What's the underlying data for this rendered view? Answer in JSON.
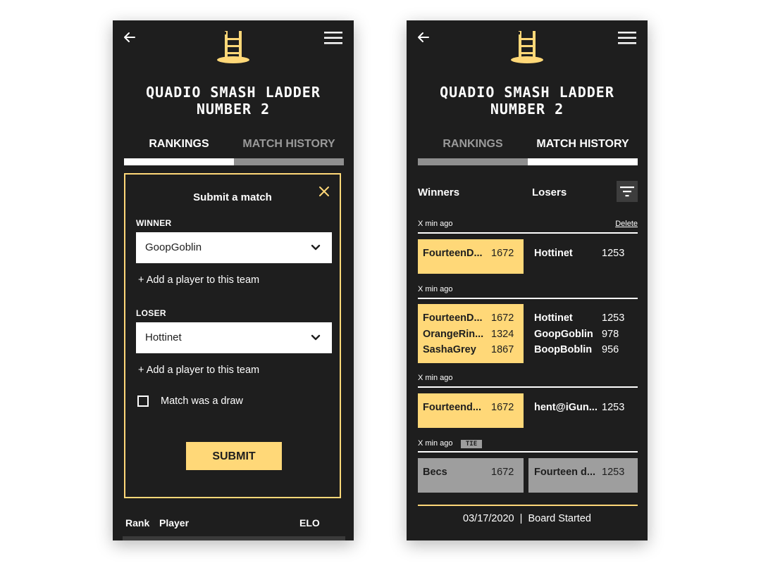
{
  "ladder_title_line1": "Quadio Smash Ladder",
  "ladder_title_line2": "Number 2",
  "tabs": {
    "rankings": "RANKINGS",
    "match_history": "MATCH HISTORY"
  },
  "colors": {
    "accent": "#ffd878",
    "background": "#1e1e1e",
    "tie": "#9e9e9e"
  },
  "submit_form": {
    "title": "Submit a match",
    "winner_label": "WINNER",
    "winner_value": "GoopGoblin",
    "add_player_winner": "+ Add a player to this team",
    "loser_label": "LOSER",
    "loser_value": "Hottinet",
    "add_player_loser": "+ Add a player to this team",
    "draw_label": "Match was a draw",
    "submit_label": "SUBMIT"
  },
  "rankings_header": {
    "rank": "Rank",
    "player": "Player",
    "elo": "ELO"
  },
  "history": {
    "winners_label": "Winners",
    "losers_label": "Losers",
    "matches": [
      {
        "time": "X min ago",
        "delete": "Delete",
        "winners": [
          {
            "name": "FourteenD...",
            "elo": "1672"
          }
        ],
        "losers": [
          {
            "name": "Hottinet",
            "elo": "1253"
          }
        ]
      },
      {
        "time": "X min ago",
        "winners": [
          {
            "name": "FourteenD...",
            "elo": "1672"
          },
          {
            "name": "OrangeRin...",
            "elo": "1324"
          },
          {
            "name": "SashaGrey",
            "elo": "1867"
          }
        ],
        "losers": [
          {
            "name": "Hottinet",
            "elo": "1253"
          },
          {
            "name": "GoopGoblin",
            "elo": "978"
          },
          {
            "name": "BoopBoblin",
            "elo": "956"
          }
        ]
      },
      {
        "time": "X min ago",
        "winners": [
          {
            "name": "Fourteend...",
            "elo": "1672"
          }
        ],
        "losers": [
          {
            "name": "hent@iGun...",
            "elo": "1253"
          }
        ]
      },
      {
        "time": "X min ago",
        "tie": "TIE",
        "winners": [
          {
            "name": "Becs",
            "elo": "1672"
          }
        ],
        "losers": [
          {
            "name": "Fourteen d...",
            "elo": "1253"
          }
        ]
      }
    ],
    "board_started": "03/17/2020  |  Board Started"
  },
  "icons": {
    "back": "back-arrow-icon",
    "menu": "hamburger-menu-icon",
    "logo": "ladder-logo-icon",
    "close": "close-icon",
    "chevron": "chevron-down-icon",
    "filter": "filter-icon"
  }
}
